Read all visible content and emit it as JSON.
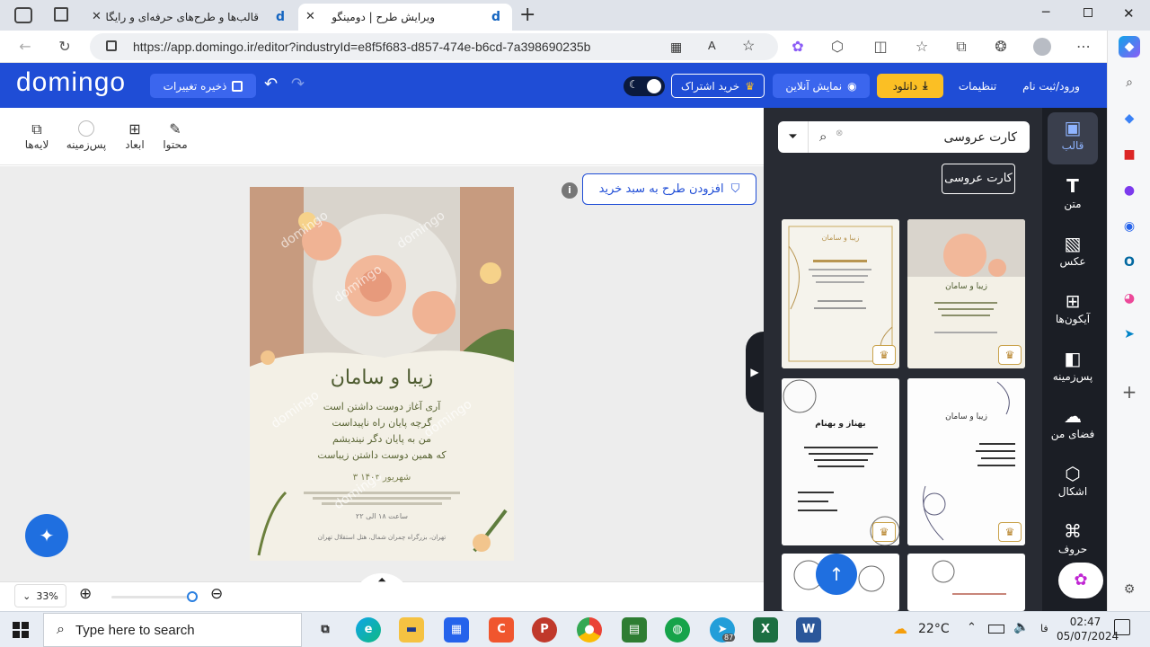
{
  "browser": {
    "tabs": [
      {
        "title": "قالب‌ها و طرح‌های حرفه‌ای و رایگان",
        "favicon": "d"
      },
      {
        "title": "ویرایش طرح | دومینگو",
        "favicon": "d"
      }
    ],
    "url": "https://app.domingo.ir/editor?industryId=e8f5f683-d857-474e-b6cd-7a398690235b"
  },
  "app": {
    "logo": "domingo",
    "save_label": "ذخیره تغییرات",
    "login_label": "ورود/ثبت نام",
    "settings_label": "تنظیمات",
    "download_label": "دانلود",
    "preview_label": "نمایش آنلاین",
    "subscribe_label": "خرید اشتراک"
  },
  "toolbar": {
    "content": "محتوا",
    "dimensions": "ابعاد",
    "background": "پس‌زمینه",
    "layers": "لایه‌ها"
  },
  "canvas": {
    "add_to_cart": "افزودن طرح به سبد خرید",
    "zoom": "33%",
    "card": {
      "names": "زیبا و سامان",
      "poem": [
        "آری آغاز دوست داشتن است",
        "گرچه پایان راه ناپیداست",
        "من به پایان دگر نیندیشم",
        "که همین دوست داشتن زیباست"
      ],
      "date": "۳ شهریور ۱۴۰۳",
      "line1": "ساعت ۱۸ الی ۲۲",
      "line2": "تهران، بزرگراه چمران شمال، هتل استقلال تهران",
      "watermark": "domingo"
    }
  },
  "panel": {
    "search_value": "کارت عروسی",
    "tag": "کارت عروسی",
    "nav": [
      {
        "label": "قالب",
        "icon": "template-icon"
      },
      {
        "label": "متن",
        "icon": "text-icon"
      },
      {
        "label": "عکس",
        "icon": "image-icon"
      },
      {
        "label": "آیکون‌ها",
        "icon": "icons-icon"
      },
      {
        "label": "پس‌زمینه",
        "icon": "background-icon"
      },
      {
        "label": "فضای من",
        "icon": "upload-icon"
      },
      {
        "label": "اشکال",
        "icon": "shapes-icon"
      },
      {
        "label": "حروف",
        "icon": "letters-icon"
      }
    ],
    "thumbs": [
      {
        "title": "زیبا و سامان"
      },
      {
        "title": "زیبا و سامان"
      },
      {
        "title": "زیبا و سامان"
      },
      {
        "title": "بهناز و بهنام"
      }
    ]
  },
  "taskbar": {
    "search_placeholder": "Type here to search",
    "temperature": "22°C",
    "lang": "فا",
    "time": "02:47",
    "date": "05/07/2024",
    "telegram_badge": "87"
  },
  "colors": {
    "brand": "#1f4dd6",
    "panel": "#282b33",
    "accent": "#fbbf24"
  }
}
